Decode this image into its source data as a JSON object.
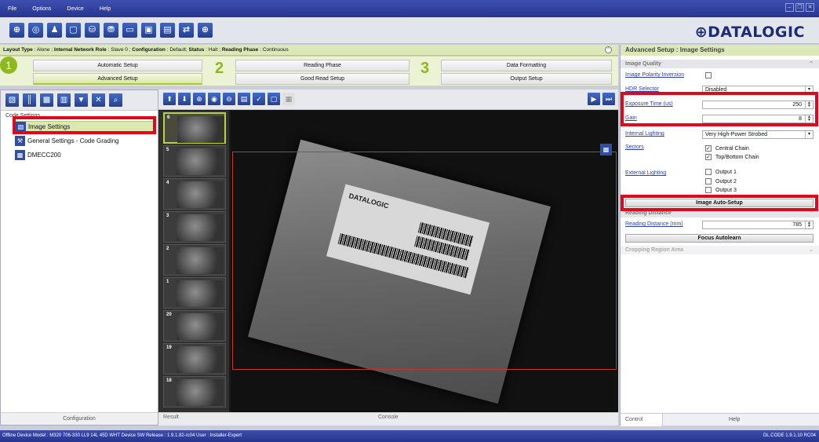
{
  "menu": [
    "File",
    "Options",
    "Device",
    "Help"
  ],
  "brand": {
    "logo": "⊕DATALOGIC",
    "accent": "#8db81e",
    "primary": "#26358f",
    "highlight": "#e0081b"
  },
  "toolbar_icons": [
    "connect-icon",
    "disconnect-icon",
    "device-icon",
    "open-icon",
    "save-to-device-icon",
    "save-config-icon",
    "monitor-icon",
    "capture-icon",
    "statistics-icon",
    "io-icon",
    "target-icon"
  ],
  "infobar": {
    "layout_type_label": "Layout Type",
    "layout_type": "Alone",
    "network_role_label": "Internal Network Role",
    "network_role": "Slave 0",
    "configuration_label": "Configuration",
    "configuration": "Default",
    "status_label": "Status",
    "status": "Halt",
    "reading_phase_label": "Reading Phase",
    "reading_phase": "Continuous"
  },
  "steps": {
    "step1": {
      "number": "1",
      "buttons": [
        "Automatic Setup",
        "Advanced Setup"
      ],
      "active": "Advanced Setup"
    },
    "step2": {
      "number": "2",
      "buttons": [
        "Reading Phase",
        "Good Read Setup"
      ]
    },
    "step3": {
      "number": "3",
      "buttons": [
        "Data Formatting",
        "Output Setup"
      ]
    }
  },
  "left_panel": {
    "tree_root": "Code Settings",
    "items": [
      {
        "label": "Image Settings",
        "selected": true
      },
      {
        "label": "General Settings - Code Grading",
        "selected": false
      },
      {
        "label": "DMECC200",
        "selected": false
      }
    ],
    "footer": "Configuration"
  },
  "center": {
    "thumbnails": [
      "6",
      "5",
      "4",
      "3",
      "2",
      "1",
      "20",
      "19",
      "18"
    ],
    "selected_thumbnail": "6",
    "tabs": [
      "Result",
      "Console"
    ],
    "image_logo": "DATALOGIC"
  },
  "right_panel": {
    "title": "Advanced Setup : Image Settings",
    "section_image_quality": "Image Quality",
    "image_polarity_label": "Image Polarity Inversion",
    "hdr_label": "HDR Selector",
    "hdr_value": "Disabled",
    "exposure_label": "Exposure Time (us)",
    "exposure_value": "250",
    "gain_label": "Gain",
    "gain_value": "8",
    "internal_lighting_label": "Internal Lighting",
    "internal_lighting_value": "Very High-Power Strobed",
    "sectors_label": "Sectors",
    "sectors": [
      "Central Chain",
      "Top/Bottom Chain"
    ],
    "external_lighting_label": "External Lighting",
    "external_outputs": [
      "Output 1",
      "Output 2",
      "Output 3"
    ],
    "auto_setup_button": "Image Auto-Setup",
    "section_reading_distance": "Reading Distance",
    "reading_distance_label": "Reading Distance (mm)",
    "reading_distance_value": "785",
    "focus_button": "Focus Autolearn",
    "section_cropping": "Cropping Region Area",
    "tabs": [
      "Control",
      "Help"
    ]
  },
  "statusbar": {
    "left": "Offline Device Model : M320 706-330 LL9 14L 45D WHT   Device SW Release : 1.9.1.82-rc04   User : Installer-Expert",
    "right": "DL.CODE 1.9.1.10 RC04"
  }
}
